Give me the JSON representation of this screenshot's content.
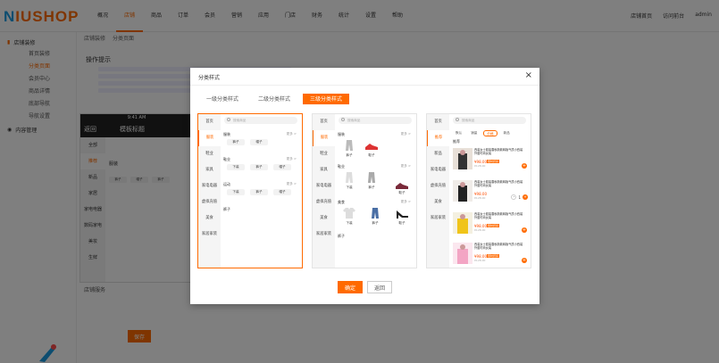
{
  "brand": {
    "n": "N",
    "rest": "IUSHOP"
  },
  "topnav": {
    "items": [
      "概况",
      "店铺",
      "商品",
      "订单",
      "会员",
      "营销",
      "应用",
      "门店",
      "财务",
      "统计",
      "设置",
      "帮助"
    ],
    "active_index": 1,
    "right": [
      "店铺首页",
      "访问前台",
      "admin"
    ]
  },
  "sidebar": {
    "group1": "店铺装修",
    "items": [
      "首页装修",
      "分类页面",
      "会员中心",
      "商品详情",
      "底部导航",
      "导航设置"
    ],
    "active_index": 1,
    "group2": "内容管理"
  },
  "breadcrumb": [
    "店铺装修",
    "分类页面"
  ],
  "tips": {
    "title": "操作提示"
  },
  "phone": {
    "status_time": "9:41 AM",
    "back": "返回",
    "title": "模板标题",
    "left": [
      "全部",
      "推荐",
      "新品",
      "家居",
      "家电电器",
      "数码家电",
      "美妆",
      "生鲜"
    ],
    "section": "服装",
    "chips": [
      "裤子",
      "帽子",
      "裤子"
    ]
  },
  "save_label_area": "店铺服务",
  "save_button": "保存",
  "modal": {
    "title": "分类样式",
    "close": "×",
    "tabs": [
      "一级分类样式",
      "二级分类样式",
      "三级分类样式"
    ],
    "active_tab": 2,
    "ok": "确定",
    "cancel": "返回"
  },
  "panel1": {
    "search": "搜索商品",
    "left": [
      "首页",
      "服装",
      "鞋业",
      "家具",
      "家电电器",
      "虚拟充值",
      "美食",
      "家居家装"
    ],
    "active": 1,
    "sections": [
      {
        "name": "服装",
        "more": "更多 >",
        "chips": [
          "裤子",
          "帽子"
        ]
      },
      {
        "name": "鞋业",
        "more": "更多 >",
        "chips": [
          "下装",
          "裤子",
          "帽子"
        ]
      },
      {
        "name": "运动",
        "more": "更多 >",
        "chips": [
          "下装",
          "裤子",
          "帽子"
        ]
      },
      {
        "name": "裤子",
        "more": "",
        "chips": []
      }
    ]
  },
  "panel2": {
    "search": "搜索商品",
    "left": [
      "首页",
      "服装",
      "鞋业",
      "家具",
      "家电电器",
      "虚拟充值",
      "美食",
      "家居家装"
    ],
    "active": 1,
    "sections": [
      {
        "name": "服装",
        "more": "更多 >",
        "items": [
          "裤子",
          "鞋子"
        ]
      },
      {
        "name": "鞋业",
        "more": "更多 >",
        "items": [
          "下装",
          "裤子",
          "鞋子"
        ]
      },
      {
        "name": "美食",
        "more": "更多 >",
        "items": [
          "下装",
          "裤子",
          "鞋子"
        ]
      },
      {
        "name": "裤子",
        "more": "",
        "items": []
      }
    ]
  },
  "panel3": {
    "search": "搜索商品",
    "left": [
      "首页",
      "推荐",
      "新品",
      "家电电器",
      "虚拟充值",
      "美食",
      "家居家装"
    ],
    "active": 1,
    "subtabs": [
      "默认",
      "销量",
      "价格",
      "新品"
    ],
    "subtab_active": 2,
    "section": "推荐",
    "products": [
      {
        "title": "西装女士套装春秋新款韩版气质小西装外套时尚女装",
        "price": "¥98.00",
        "tag": "限时折扣",
        "old": "¥128.00"
      },
      {
        "title": "西装女士套装春秋新款韩版气质小西装外套时尚女装",
        "price": "¥98.00",
        "tag": "限时折扣",
        "old": "¥128.00"
      },
      {
        "title": "西装女士套装春秋新款韩版气质小西装外套时尚女装",
        "price": "¥98.00",
        "tag": "限时折扣",
        "old": "¥128.00"
      },
      {
        "title": "西装女士套装春秋新款韩版气质小西装外套时尚女装",
        "price": "¥98.00",
        "tag": "限时折扣",
        "old": "¥128.00"
      }
    ],
    "stepper_value": "1"
  },
  "colors": {
    "accent": "#ff6a00",
    "brand_blue": "#1b9be0"
  }
}
